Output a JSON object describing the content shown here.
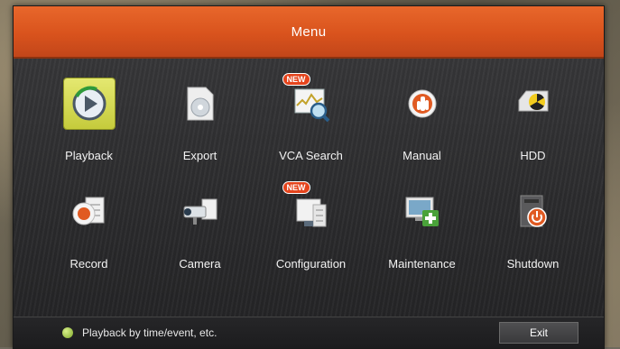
{
  "window": {
    "title": "Menu"
  },
  "menu": {
    "items": [
      {
        "label": "Playback",
        "icon": "playback-icon",
        "selected": true,
        "new": false
      },
      {
        "label": "Export",
        "icon": "export-icon",
        "selected": false,
        "new": false
      },
      {
        "label": "VCA Search",
        "icon": "vca-search-icon",
        "selected": false,
        "new": true
      },
      {
        "label": "Manual",
        "icon": "manual-icon",
        "selected": false,
        "new": false
      },
      {
        "label": "HDD",
        "icon": "hdd-icon",
        "selected": false,
        "new": false
      },
      {
        "label": "Record",
        "icon": "record-icon",
        "selected": false,
        "new": false
      },
      {
        "label": "Camera",
        "icon": "camera-icon",
        "selected": false,
        "new": false
      },
      {
        "label": "Configuration",
        "icon": "configuration-icon",
        "selected": false,
        "new": true
      },
      {
        "label": "Maintenance",
        "icon": "maintenance-icon",
        "selected": false,
        "new": false
      },
      {
        "label": "Shutdown",
        "icon": "shutdown-icon",
        "selected": false,
        "new": false
      }
    ],
    "new_badge": "NEW"
  },
  "status": {
    "hint": "Playback by time/event, etc.",
    "exit_label": "Exit"
  },
  "colors": {
    "accent": "#e05a22",
    "selected": "#d5da4e"
  }
}
